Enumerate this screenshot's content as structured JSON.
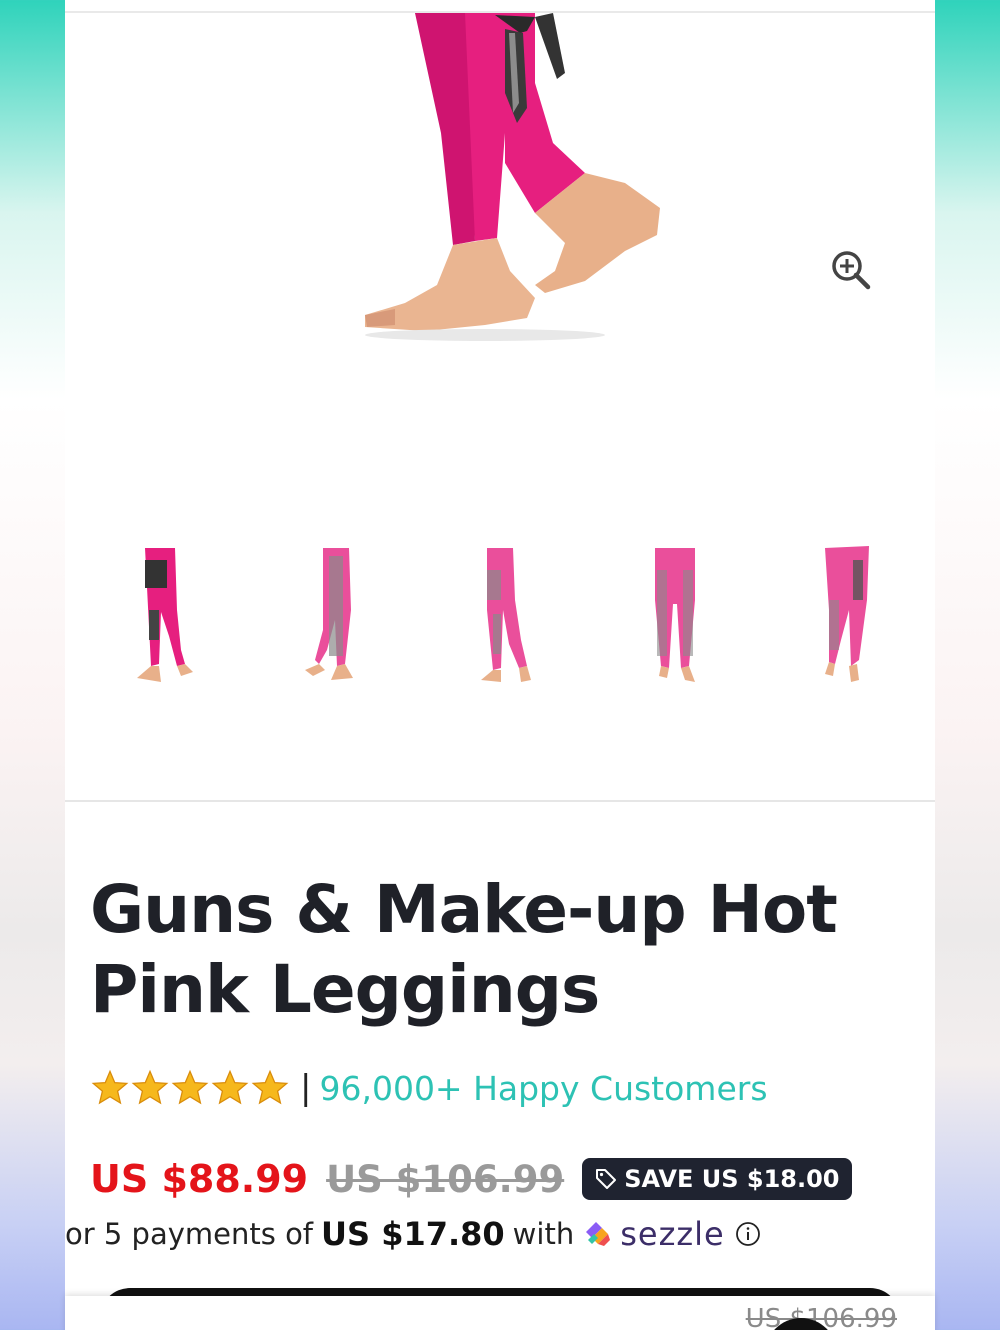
{
  "product": {
    "title": "Guns & Make-up Hot Pink Leggings",
    "image_alt": "Pink leggings with black gun print",
    "zoom_icon": "zoom-in-icon",
    "thumbnails": [
      {
        "name": "thumb-side-left"
      },
      {
        "name": "thumb-side-right"
      },
      {
        "name": "thumb-three-quarter"
      },
      {
        "name": "thumb-back"
      },
      {
        "name": "thumb-side-back"
      }
    ]
  },
  "rating": {
    "stars": 5,
    "separator": "|",
    "customers_text": "96,000+ Happy Customers"
  },
  "pricing": {
    "current": "US $88.99",
    "original": "US $106.99",
    "save_badge": "SAVE US $18.00",
    "payments_prefix": "or 5 payments of",
    "payment_amount": "US $17.80",
    "payments_with": "with",
    "provider": "sezzle"
  },
  "sticky_bar": {
    "original_price": "US $106.99"
  },
  "colors": {
    "accent_teal": "#2dc2b4",
    "sale_red": "#e4141a",
    "legging_pink": "#e61f7f",
    "badge_dark": "#1f2330"
  }
}
